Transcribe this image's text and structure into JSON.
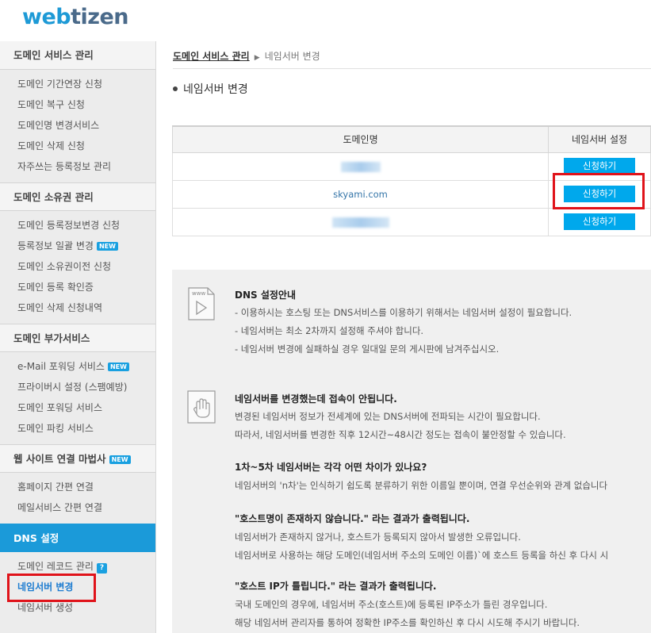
{
  "brand": {
    "logo_part1": "web",
    "logo_part2": "tizen"
  },
  "sidebar": {
    "sections": [
      {
        "title": "도메인 서비스 관리",
        "items": [
          {
            "label": "도메인 기간연장 신청"
          },
          {
            "label": "도메인 복구 신청"
          },
          {
            "label": "도메인명 변경서비스"
          },
          {
            "label": "도메인 삭제 신청"
          },
          {
            "label": "자주쓰는 등록정보 관리"
          }
        ]
      },
      {
        "title": "도메인 소유권 관리",
        "items": [
          {
            "label": "도메인 등록정보변경 신청"
          },
          {
            "label": "등록정보 일괄 변경",
            "badge": "NEW"
          },
          {
            "label": "도메인 소유권이전 신청"
          },
          {
            "label": "도메인 등록 확인증"
          },
          {
            "label": "도메인 삭제 신청내역"
          }
        ]
      },
      {
        "title": "도메인 부가서비스",
        "items": [
          {
            "label": "e-Mail 포워딩 서비스",
            "badge": "NEW"
          },
          {
            "label": "프라이버시 설정 (스팸예방)"
          },
          {
            "label": "도메인 포워딩 서비스"
          },
          {
            "label": "도메인 파킹 서비스"
          }
        ]
      },
      {
        "title": "웹 사이트 연결 마법사",
        "badge": "NEW",
        "items": [
          {
            "label": "홈페이지 간편 연결"
          },
          {
            "label": "메일서비스 간편 연결"
          }
        ]
      },
      {
        "title": "DNS 설정",
        "items": [
          {
            "label": "도메인 레코드 관리",
            "badge": "?"
          },
          {
            "label": "네임서버 변경"
          },
          {
            "label": "네임서버 생성"
          }
        ]
      }
    ]
  },
  "breadcrumb": {
    "parent": "도메인 서비스 관리",
    "current": "네임서버 변경",
    "separator": "▶"
  },
  "page": {
    "title": "네임서버 변경"
  },
  "table": {
    "headers": [
      "도메인명",
      "네임서버 설정"
    ],
    "rows": [
      {
        "domain": "",
        "button": "신청하기"
      },
      {
        "domain": "skyami.com",
        "button": "신청하기"
      },
      {
        "domain": "",
        "button": "신청하기"
      }
    ]
  },
  "guide": {
    "dns": {
      "icon": "www-document-icon",
      "title": "DNS 설정안내",
      "lines": [
        "- 이용하시는 호스팅 또는 DNS서비스를 이용하기 위해서는 네임서버 설정이 필요합니다.",
        "- 네임서버는 최소 2차까지 설정해 주셔야 합니다.",
        "- 네임서버 변경에 실패하실 경우 일대일 문의 게시판에 남겨주십시오."
      ]
    },
    "faq": {
      "icon": "hand-icon",
      "items": [
        {
          "title": "네임서버를 변경했는데 접속이 안됩니다.",
          "lines": [
            "변경된 네임서버 정보가 전세계에 있는 DNS서버에 전파되는 시간이 필요합니다.",
            "따라서, 네임서버를 변경한 직후 12시간~48시간 정도는 접속이 불안정할 수 있습니다."
          ]
        },
        {
          "title": "1차~5차 네임서버는 각각 어떤 차이가 있나요?",
          "lines": [
            "네임서버의 'n차'는 인식하기 쉽도록 분류하기 위한 이름일 뿐이며, 연결 우선순위와 관계 없습니다"
          ]
        },
        {
          "title": "\"호스트명이 존재하지 않습니다.\" 라는 결과가 출력됩니다.",
          "lines": [
            "네임서버가 존재하지 않거나, 호스트가 등록되지 않아서 발생한 오류입니다.",
            "네임서버로 사용하는 해당 도메인(네임서버 주소의 도메인 이름)`에 호스트 등록을 하신 후 다시 시"
          ]
        },
        {
          "title": "\"호스트 IP가 틀립니다.\" 라는 결과가 출력됩니다.",
          "lines": [
            "국내 도메인의 경우에, 네임서버 주소(호스트)에 등록된 IP주소가 틀린 경우입니다.",
            "해당 네임서버 관리자를 통하여 정확한 IP주소를 확인하신 후 다시 시도해 주시기 바랍니다."
          ]
        }
      ]
    }
  },
  "colors": {
    "accent": "#00a8ec",
    "highlight": "#e0131a",
    "active_section": "#1b9ad9"
  }
}
